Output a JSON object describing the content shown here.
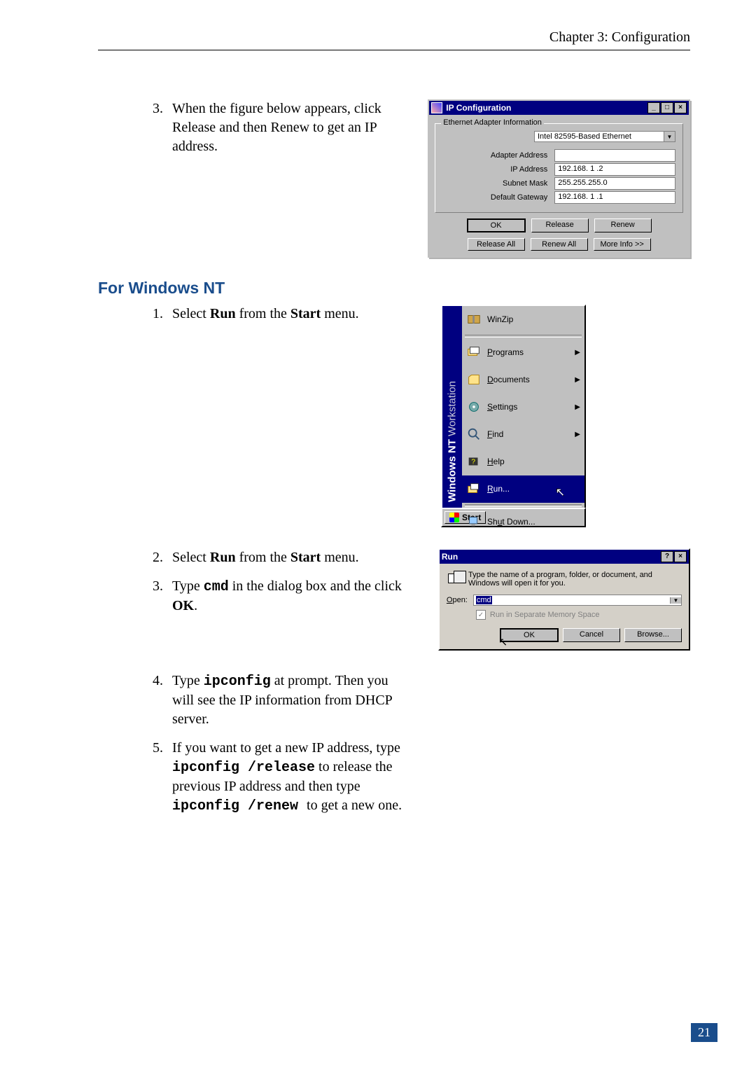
{
  "header": {
    "chapter": "Chapter 3: Configuration"
  },
  "pagenum": "21",
  "step3_top": {
    "num": "3",
    "text_before": "When the figure below appears, click Release and then Renew to get an IP address."
  },
  "section_nt_title": "For Windows NT",
  "nt_steps": {
    "s1": {
      "pre": "Select ",
      "b1": "Run",
      "mid": " from the ",
      "b2": "Start",
      "post": " menu."
    },
    "s2": {
      "pre": "Select ",
      "b1": "Run",
      "mid": " from the ",
      "b2": "Start",
      "post": " menu."
    },
    "s3": {
      "pre": "Type ",
      "cmd": "cmd",
      "mid": " in the dialog box and the click ",
      "ok": "OK",
      "post": "."
    },
    "s4": {
      "pre": "Type ",
      "cmd": "ipconfig",
      "post": " at prompt. Then you will see the IP information from DHCP server."
    },
    "s5": {
      "pre": "If you want to get a new IP address, type ",
      "cmd1": "ipconfig /release",
      "mid": " to release the previous IP address and then type ",
      "cmd2": "ipconfig /renew ",
      "post": " to get a new one."
    }
  },
  "ipconfig_window": {
    "title": "IP Configuration",
    "group_label": "Ethernet Adapter Information",
    "adapter_selected": "Intel 82595-Based Ethernet",
    "rows": {
      "adapter_address": {
        "label": "Adapter Address",
        "value": ""
      },
      "ip_address": {
        "label": "IP Address",
        "value": "192.168.  1  .2"
      },
      "subnet_mask": {
        "label": "Subnet Mask",
        "value": "255.255.255.0"
      },
      "default_gateway": {
        "label": "Default Gateway",
        "value": "192.168.  1  .1"
      }
    },
    "buttons": {
      "ok": "OK",
      "release": "Release",
      "renew": "Renew",
      "release_all": "Release All",
      "renew_all": "Renew All",
      "more_info": "More Info >>"
    }
  },
  "start_menu": {
    "side_bold": "Windows NT",
    "side_rest": " Workstation",
    "items": {
      "winzip": {
        "label": "WinZip",
        "under": ""
      },
      "programs": {
        "label": "Programs",
        "under": "P",
        "arrow": true
      },
      "documents": {
        "label": "Documents",
        "under": "D",
        "arrow": true
      },
      "settings": {
        "label": "Settings",
        "under": "S",
        "arrow": true
      },
      "find": {
        "label": "Find",
        "under": "F",
        "arrow": true
      },
      "help": {
        "label": "Help",
        "under": "H"
      },
      "run": {
        "label": "Run...",
        "under": "R",
        "selected": true
      },
      "shutdown": {
        "label": "Shut Down...",
        "under": "u"
      }
    },
    "start_button": "Start"
  },
  "run_dialog": {
    "title": "Run",
    "description": "Type the name of a program, folder, or document, and Windows will open it for you.",
    "open_label": "Open:",
    "open_value": "cmd",
    "separate_mem": "Run in Separate Memory Space",
    "buttons": {
      "ok": "OK",
      "cancel": "Cancel",
      "browse": "Browse..."
    }
  }
}
